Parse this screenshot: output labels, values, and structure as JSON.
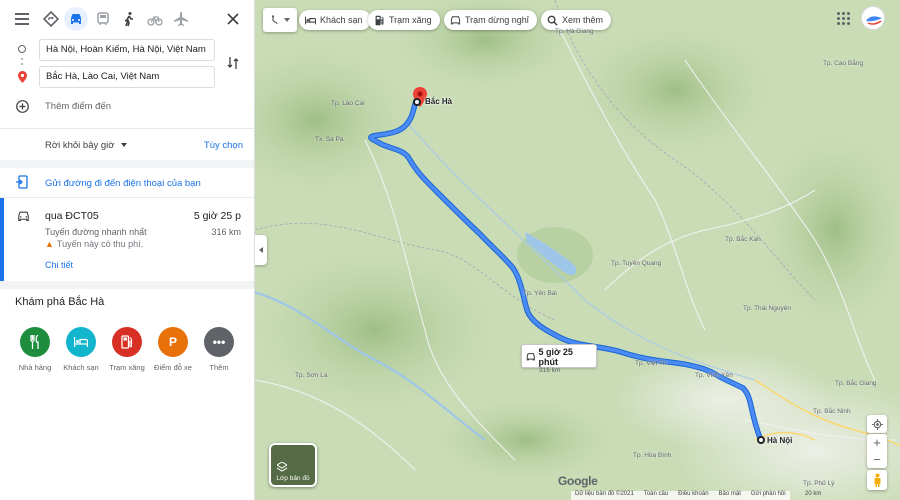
{
  "panel": {
    "modes": [
      {
        "name": "best-mode-icon",
        "active": false
      },
      {
        "name": "car-icon",
        "active": true
      },
      {
        "name": "transit-icon",
        "active": false
      },
      {
        "name": "walk-icon",
        "active": false
      },
      {
        "name": "bike-icon",
        "active": false
      },
      {
        "name": "flight-icon",
        "active": false
      }
    ],
    "origin": "Hà Nội, Hoàn Kiếm, Hà Nội, Việt Nam",
    "destination": "Bắc Hà, Lào Cai, Việt Nam",
    "add_destination": "Thêm điểm đến",
    "depart_label": "Rời khỏi bây giờ",
    "options_label": "Tùy chọn",
    "send_to_phone": "Gửi đường đi đến điện thoại của bạn",
    "route": {
      "via": "qua ĐCT05",
      "duration": "5 giờ 25 p",
      "subtitle": "Tuyến đường nhanh nhất",
      "distance": "316 km",
      "toll_warning": "Tuyến này có thu phí.",
      "details_link": "Chi tiết"
    },
    "explore": {
      "title": "Khám phá Bắc Hà",
      "items": [
        {
          "label": "Nhà hàng",
          "color": "#1e8e3e",
          "icon": "restaurant-icon"
        },
        {
          "label": "Khách sạn",
          "color": "#12b5cb",
          "icon": "hotel-icon"
        },
        {
          "label": "Trạm xăng",
          "color": "#d93025",
          "icon": "gas-station-icon"
        },
        {
          "label": "Điểm đỗ xe",
          "color": "#e8710a",
          "icon": "parking-icon"
        },
        {
          "label": "Thêm",
          "color": "#5f6368",
          "icon": "more-icon"
        }
      ]
    }
  },
  "map": {
    "chips": [
      {
        "label": "Khách sạn",
        "icon": "hotel-icon"
      },
      {
        "label": "Trạm xăng",
        "icon": "gas-station-icon"
      },
      {
        "label": "Trạm dừng nghỉ",
        "icon": "rest-stop-icon"
      },
      {
        "label": "Xem thêm",
        "icon": "search-icon"
      }
    ],
    "start_label": "Bắc Hà",
    "end_label": "Hà Nội",
    "bubble_time": "5 giờ 25 phút",
    "bubble_distance": "316 km",
    "layers_label": "Lớp bản đồ",
    "google": "Google",
    "footer": [
      "Dữ liệu bản đồ ©2021",
      "Toàn cầu",
      "Điều khoản",
      "Bảo mật",
      "Gửi phản hồi"
    ],
    "scale": "20 km",
    "place_labels": [
      {
        "text": "Tp. Lào Cai"
      },
      {
        "text": "Tx. Sa Pa"
      },
      {
        "text": "Tp. Yên Bái"
      },
      {
        "text": "Tp. Tuyên Quang"
      },
      {
        "text": "Tp. Bắc Kạn"
      },
      {
        "text": "Tp. Thái Nguyên"
      },
      {
        "text": "Tp. Việt Trì"
      },
      {
        "text": "Tp. Vĩnh Yên"
      },
      {
        "text": "Tp. Hòa Bình"
      },
      {
        "text": "Tp. Sơn La"
      },
      {
        "text": "Tp. Bắc Ninh"
      },
      {
        "text": "Tp. Bắc Giang"
      },
      {
        "text": "Tp. Hà Giang"
      },
      {
        "text": "Tp. Cao Bằng"
      },
      {
        "text": "Tp. Phủ Lý"
      }
    ],
    "route_color": "#1a73e8"
  }
}
